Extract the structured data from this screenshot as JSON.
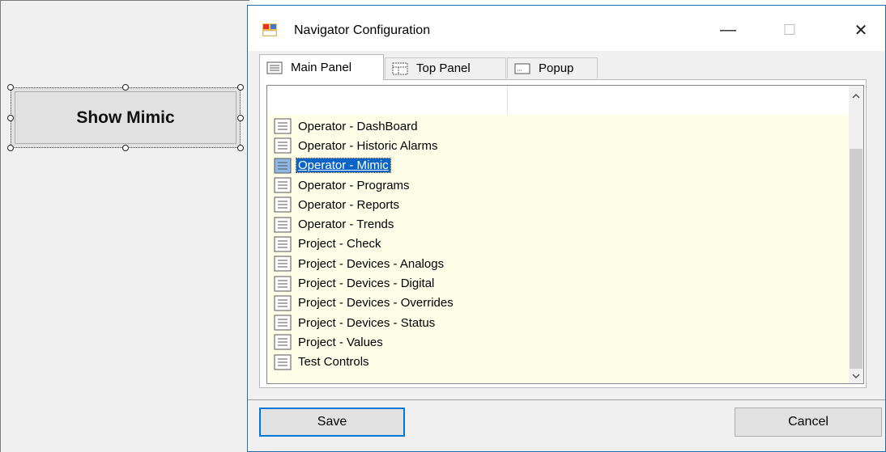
{
  "designer": {
    "button_label": "Show Mimic"
  },
  "dialog": {
    "title": "Navigator Configuration",
    "controls": {
      "minimize": "—",
      "maximize": "☐",
      "close": "✕"
    },
    "tabs": [
      {
        "label": "Main Panel",
        "icon": "list-icon",
        "active": true
      },
      {
        "label": "Top Panel",
        "icon": "layout-icon",
        "active": false
      },
      {
        "label": "Popup",
        "icon": "popup-icon",
        "active": false
      }
    ],
    "items": [
      {
        "label": "Operator - DashBoard"
      },
      {
        "label": "Operator - Historic Alarms"
      },
      {
        "label": "Operator - Mimic",
        "selected": true
      },
      {
        "label": "Operator - Programs"
      },
      {
        "label": "Operator - Reports"
      },
      {
        "label": "Operator - Trends"
      },
      {
        "label": "Project - Check"
      },
      {
        "label": "Project - Devices - Analogs"
      },
      {
        "label": "Project - Devices - Digital"
      },
      {
        "label": "Project - Devices - Overrides"
      },
      {
        "label": "Project - Devices - Status"
      },
      {
        "label": "Project - Values"
      },
      {
        "label": "Test Controls"
      }
    ],
    "save_label": "Save",
    "cancel_label": "Cancel"
  },
  "colors": {
    "selection": "#0a64c8",
    "list_background": "#fdfde8",
    "default_button_border": "#0078d7"
  }
}
